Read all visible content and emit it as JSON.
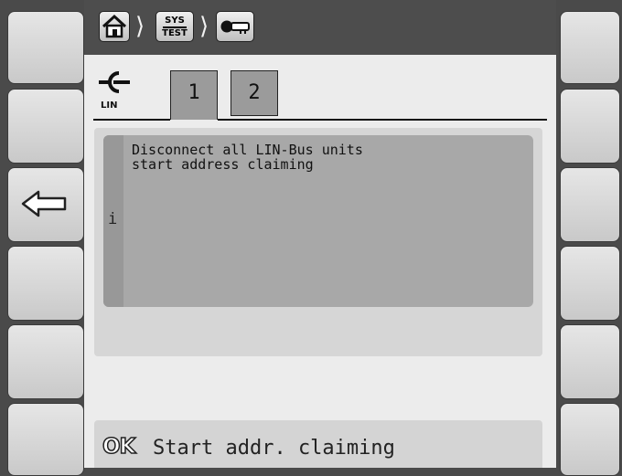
{
  "softkeys": {
    "left": [
      {
        "name": "softkey-left-1",
        "icon": ""
      },
      {
        "name": "softkey-left-2",
        "icon": ""
      },
      {
        "name": "softkey-left-3",
        "icon": "arrow-left-icon"
      },
      {
        "name": "softkey-left-4",
        "icon": ""
      },
      {
        "name": "softkey-left-5",
        "icon": ""
      },
      {
        "name": "softkey-left-6",
        "icon": ""
      }
    ],
    "right": [
      {
        "name": "softkey-right-1",
        "icon": ""
      },
      {
        "name": "softkey-right-2",
        "icon": ""
      },
      {
        "name": "softkey-right-3",
        "icon": ""
      },
      {
        "name": "softkey-right-4",
        "icon": ""
      },
      {
        "name": "softkey-right-5",
        "icon": ""
      },
      {
        "name": "softkey-right-6",
        "icon": ""
      }
    ]
  },
  "breadcrumb": {
    "items": [
      {
        "icon": "home-icon"
      },
      {
        "icon": "sys-test-icon",
        "line1": "SYS",
        "line2": "TEST"
      },
      {
        "icon": "key-icon"
      }
    ],
    "separator": "⟩"
  },
  "header": {
    "lin_label": "LIN",
    "lin_icon": "lin-connector-icon"
  },
  "tabs": [
    {
      "label": "1",
      "active": true
    },
    {
      "label": "2",
      "active": false
    }
  ],
  "message": {
    "text": "Disconnect all LIN-Bus units\nstart address claiming",
    "badge": "i"
  },
  "ok_action": {
    "icon_text": "OK",
    "label": "Start addr. claiming"
  },
  "colors": {
    "frame": "#4a4a4a",
    "screen_bg": "#ececec",
    "panel": "#d6d6d6",
    "message_bg": "#a8a8a8",
    "tab": "#9b9b9b"
  }
}
